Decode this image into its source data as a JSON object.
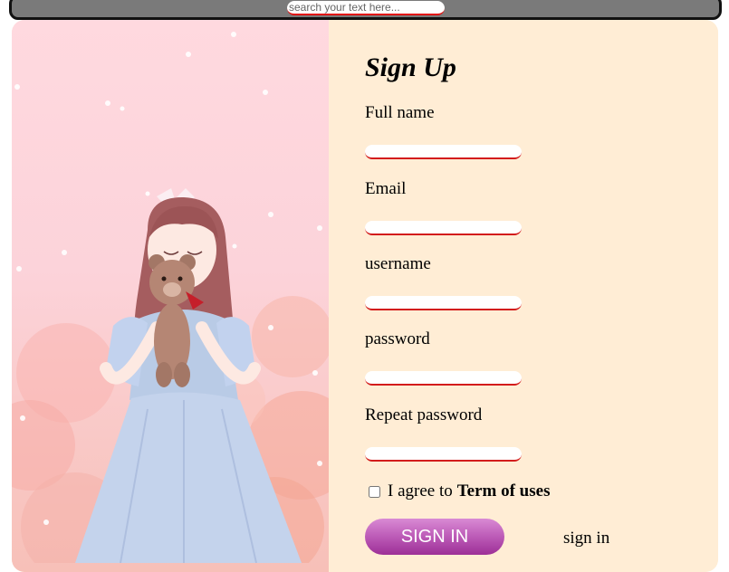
{
  "search": {
    "placeholder": "search your text here..."
  },
  "form": {
    "title": "Sign Up",
    "fields": [
      {
        "label": "Full name",
        "value": ""
      },
      {
        "label": "Email",
        "value": ""
      },
      {
        "label": "username",
        "value": ""
      },
      {
        "label": "password",
        "value": ""
      },
      {
        "label": "Repeat password",
        "value": ""
      }
    ],
    "agree_text": "I agree to",
    "terms_text": "Term of uses",
    "agree_checked": false,
    "submit_label": "SIGN IN",
    "signin_link_text": "sign in"
  },
  "colors": {
    "form_background": "#ffedd5",
    "field_underline": "#d31c1c",
    "button_gradient": [
      "#d98ad4",
      "#9d2f97"
    ],
    "illustration_background": "#ffd9df"
  }
}
